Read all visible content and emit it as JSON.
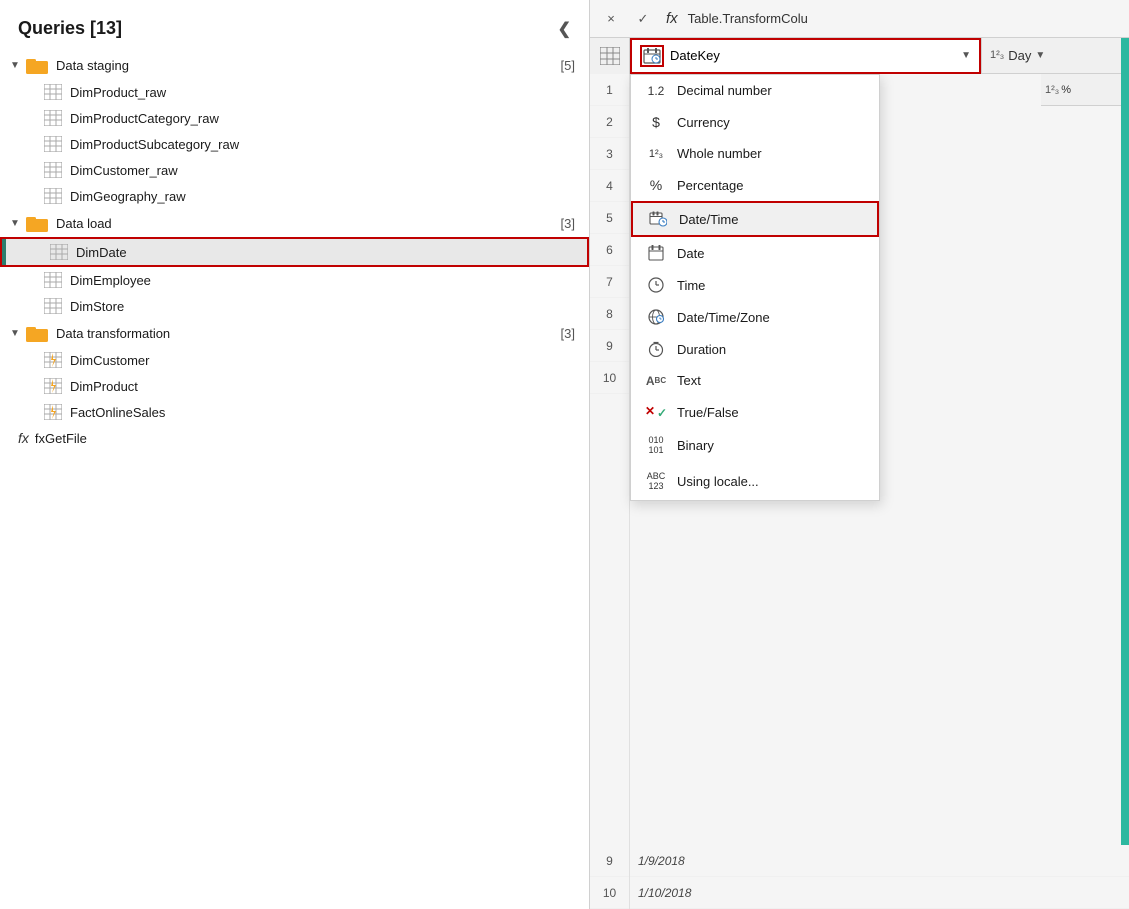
{
  "leftPanel": {
    "title": "Queries [13]",
    "groups": [
      {
        "name": "Data staging",
        "count": "[5]",
        "expanded": true,
        "items": [
          {
            "name": "DimProduct_raw",
            "type": "table"
          },
          {
            "name": "DimProductCategory_raw",
            "type": "table"
          },
          {
            "name": "DimProductSubcategory_raw",
            "type": "table"
          },
          {
            "name": "DimCustomer_raw",
            "type": "table"
          },
          {
            "name": "DimGeography_raw",
            "type": "table"
          }
        ]
      },
      {
        "name": "Data load",
        "count": "[3]",
        "expanded": true,
        "items": [
          {
            "name": "DimDate",
            "type": "table",
            "selected": true
          },
          {
            "name": "DimEmployee",
            "type": "table"
          },
          {
            "name": "DimStore",
            "type": "table"
          }
        ]
      },
      {
        "name": "Data transformation",
        "count": "[3]",
        "expanded": true,
        "items": [
          {
            "name": "DimCustomer",
            "type": "table-lightning"
          },
          {
            "name": "DimProduct",
            "type": "table-lightning"
          },
          {
            "name": "FactOnlineSales",
            "type": "table-lightning"
          }
        ]
      }
    ],
    "fxItem": "fxGetFile"
  },
  "rightPanel": {
    "formulaBar": {
      "cancelLabel": "×",
      "confirmLabel": "✓",
      "fxLabel": "fx",
      "formulaText": "Table.TransformColu"
    },
    "columnHeader": {
      "gridIconLabel": "⊞",
      "calendarIconLabel": "📅",
      "columnName": "DateKey",
      "dropdownArrow": "▼",
      "typeIcon": "1²₃",
      "typeName": "Day",
      "typeDropdownArrow": "▼"
    },
    "dropdownMenu": {
      "items": [
        {
          "icon": "1.2",
          "label": "Decimal number",
          "iconType": "text"
        },
        {
          "icon": "$",
          "label": "Currency",
          "iconType": "text"
        },
        {
          "icon": "1²₃",
          "label": "Whole number",
          "iconType": "text"
        },
        {
          "icon": "%",
          "label": "Percentage",
          "iconType": "text"
        },
        {
          "icon": "datetime",
          "label": "Date/Time",
          "iconType": "svg",
          "highlighted": true
        },
        {
          "icon": "date",
          "label": "Date",
          "iconType": "svg"
        },
        {
          "icon": "time",
          "label": "Time",
          "iconType": "svg"
        },
        {
          "icon": "globe",
          "label": "Date/Time/Zone",
          "iconType": "svg"
        },
        {
          "icon": "stopwatch",
          "label": "Duration",
          "iconType": "svg"
        },
        {
          "icon": "ABC",
          "label": "Text",
          "iconType": "text"
        },
        {
          "icon": "x/check",
          "label": "True/False",
          "iconType": "svg"
        },
        {
          "icon": "010101",
          "label": "Binary",
          "iconType": "text"
        },
        {
          "icon": "ABC123",
          "label": "Using locale...",
          "iconType": "text"
        }
      ]
    },
    "dataRows": [
      {
        "num": "1",
        "val": ""
      },
      {
        "num": "2",
        "val": ""
      },
      {
        "num": "3",
        "val": ""
      },
      {
        "num": "4",
        "val": ""
      },
      {
        "num": "5",
        "val": ""
      },
      {
        "num": "6",
        "val": ""
      },
      {
        "num": "7",
        "val": ""
      },
      {
        "num": "8",
        "val": ""
      },
      {
        "num": "9",
        "val": "1/9/2018"
      },
      {
        "num": "10",
        "val": "1/10/2018"
      }
    ]
  }
}
